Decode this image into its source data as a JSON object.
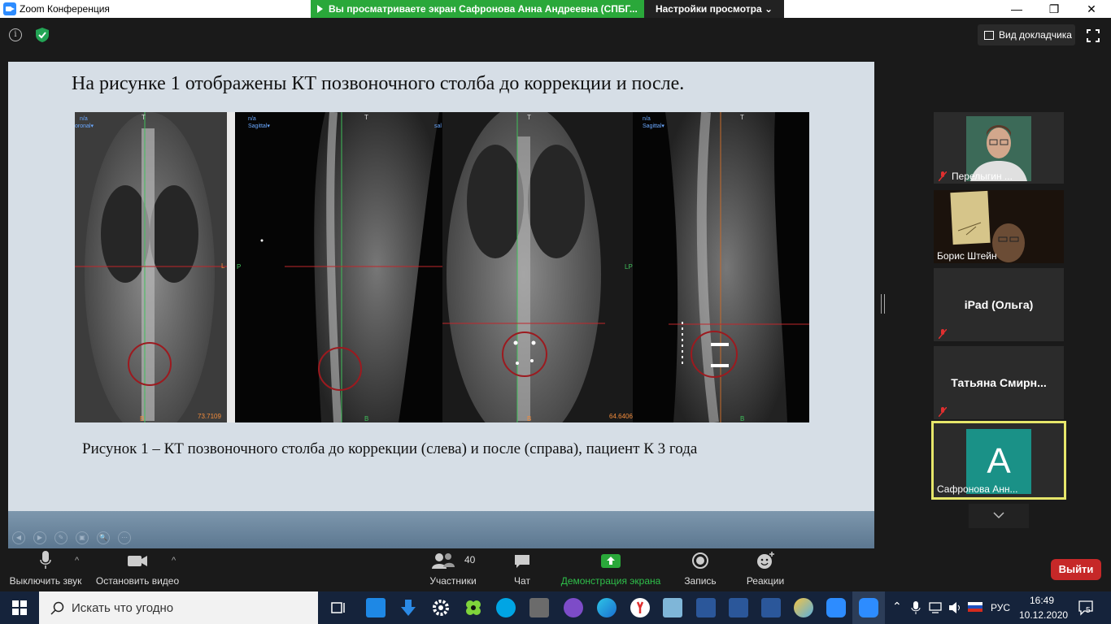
{
  "window": {
    "title": "Zoom Конференция",
    "controls": {
      "minimize": "—",
      "maximize": "❐",
      "close": "✕"
    }
  },
  "share_banner": {
    "text": "Вы  просматриваете экран Сафронова Анна Андреевна (СПБГ...",
    "view_settings": "Настройки просмотра",
    "view_settings_chevron": "⌄",
    "color": "#2aa83a"
  },
  "topbar": {
    "info_glyph": "i",
    "speaker_view_label": "Вид докладчика"
  },
  "slide": {
    "title": "На рисунке 1 отображены КТ позвоночного столба до коррекции и после.",
    "caption": "Рисунок 1 – КТ позвоночного столба до коррекции (слева) и после (справа), пациент К 3 года",
    "ct_panels": [
      {
        "view": "coronal",
        "header": "n/a",
        "subheader": "oronal▾",
        "top_marker": "T",
        "bottom_marker": "B",
        "side_marker": "L",
        "scale": "73.7109"
      },
      {
        "view": "sagittal",
        "header": "n/a",
        "subheader": "Sagittal▾",
        "top_marker": "T",
        "bottom_marker": "B",
        "side_marker": "P"
      },
      {
        "view": "coronal",
        "header": "",
        "subheader": "sal",
        "top_marker": "T",
        "bottom_marker": "B",
        "side_marker": "LP",
        "scale": "64.6406"
      },
      {
        "view": "sagittal",
        "header": "n/a",
        "subheader": "Sagittal▾",
        "top_marker": "T",
        "bottom_marker": "B"
      }
    ],
    "controls": [
      "◀",
      "▶",
      "✎",
      "▣",
      "🔍",
      "⋯"
    ]
  },
  "participants": [
    {
      "name": "Перелыгин ...",
      "muted": true,
      "has_video": true
    },
    {
      "name": "Борис Штейн",
      "muted": false,
      "has_video": true
    },
    {
      "name": "iPad (Ольга)",
      "muted": true,
      "has_video": false
    },
    {
      "name": "Татьяна  Смирн...",
      "muted": true,
      "has_video": false
    },
    {
      "name": "Сафронова Анн...",
      "muted": false,
      "has_video": false,
      "avatar_letter": "A",
      "avatar_color": "#1a9187",
      "active_speaker": true
    }
  ],
  "toolbar": {
    "mute": "Выключить звук",
    "stop_video": "Остановить видео",
    "participants": "Участники",
    "participants_count": "40",
    "chat": "Чат",
    "share_screen": "Демонстрация экрана",
    "record": "Запись",
    "reactions": "Реакции",
    "leave": "Выйти",
    "share_color": "#2aa83a",
    "leave_color": "#c62828",
    "caret": "^"
  },
  "taskbar": {
    "search_placeholder": "Искать что угодно",
    "language": "РУС",
    "time": "16:49",
    "date": "10.12.2020",
    "notification_count": "5",
    "apps": [
      "task-view-icon",
      "monitor-icon",
      "download-icon",
      "gear-icon",
      "clover-icon",
      "skype-icon",
      "calculator-icon",
      "viber-icon",
      "edge-icon",
      "yandex-icon",
      "notepad-icon",
      "word-icon",
      "word-icon",
      "word-icon",
      "paint-icon",
      "zoom-icon",
      "zoom-icon"
    ]
  }
}
